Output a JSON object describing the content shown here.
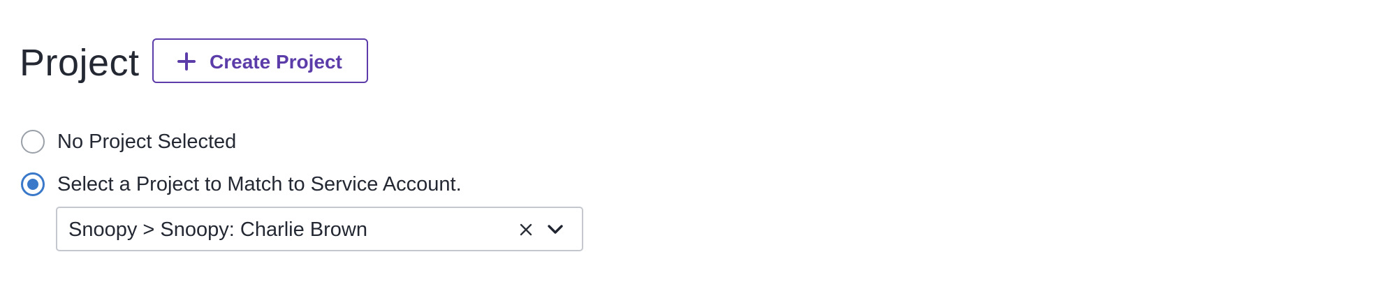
{
  "header": {
    "title": "Project",
    "create_button_label": "Create Project",
    "create_button_icon": "plus-icon"
  },
  "project_options": {
    "options": [
      {
        "label": "No Project Selected",
        "selected": false
      },
      {
        "label": "Select a Project to Match to Service Account.",
        "selected": true
      }
    ]
  },
  "project_select": {
    "value": "Snoopy > Snoopy: Charlie Brown",
    "clear_icon": "close-icon",
    "toggle_icon": "chevron-down-icon"
  },
  "colors": {
    "accent_purple": "#5b3ca8",
    "radio_blue": "#3a78c9",
    "text": "#232833",
    "border_gray": "#c4c8ce"
  }
}
